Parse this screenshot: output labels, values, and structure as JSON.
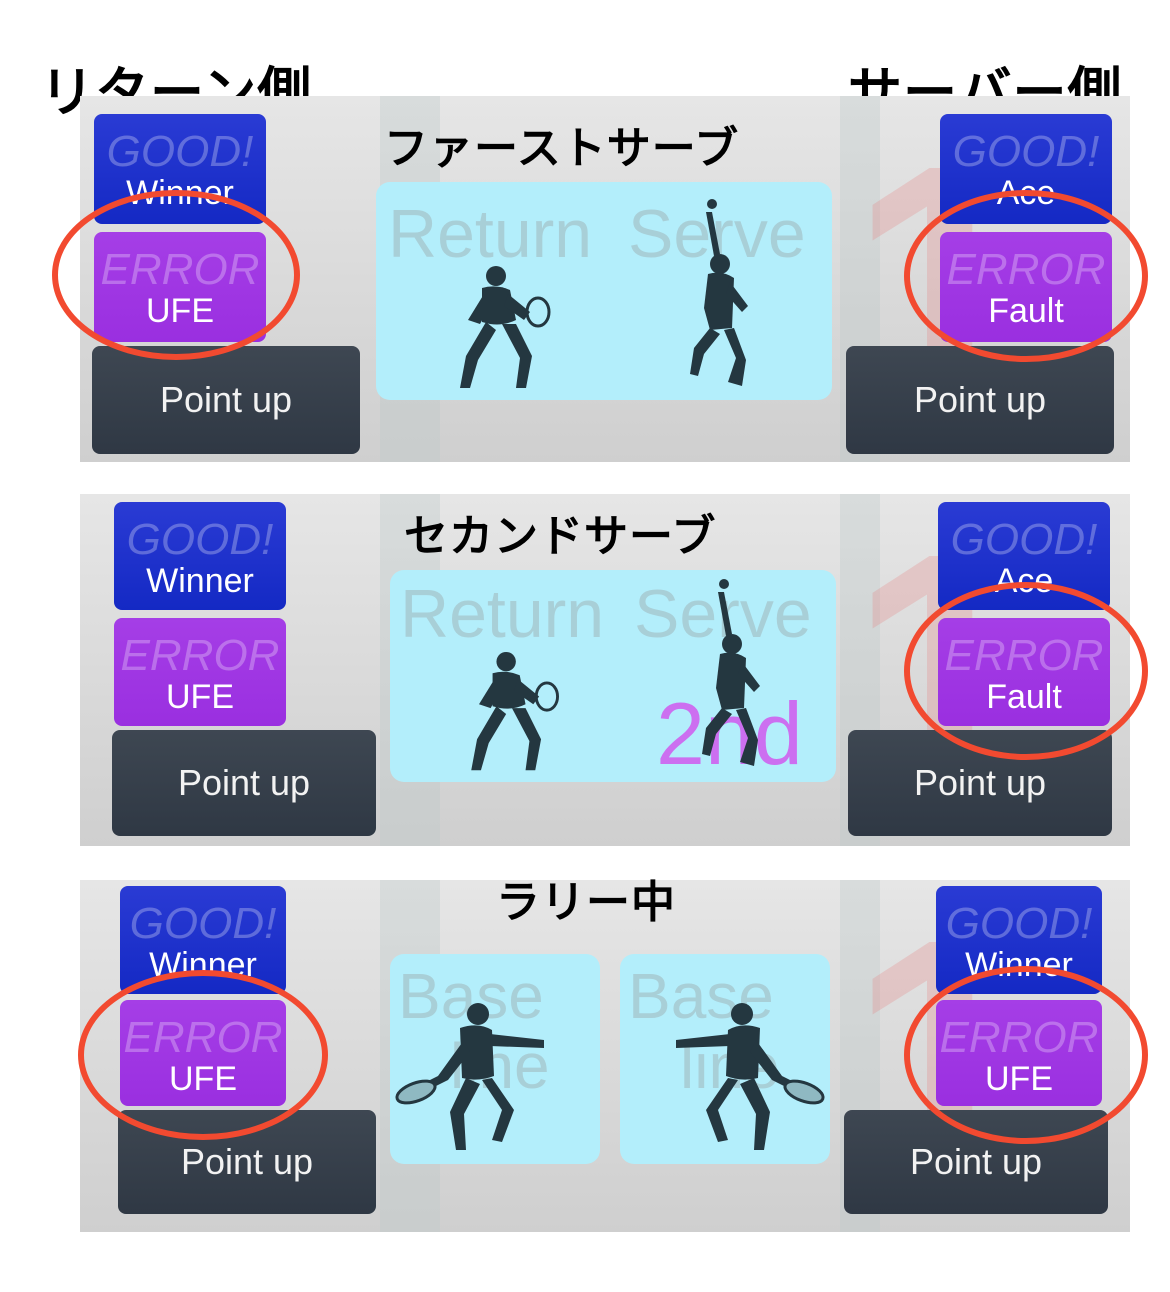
{
  "labels": {
    "return_side": "リターン側",
    "server_side": "サーバー側"
  },
  "panels": [
    {
      "title": "ファーストサーブ",
      "left": {
        "good_top": "GOOD!",
        "good_main": "Winner",
        "error_top": "ERROR",
        "error_main": "UFE",
        "point": "Point up"
      },
      "right": {
        "good_top": "GOOD!",
        "good_main": "Ace",
        "error_top": "ERROR",
        "error_main": "Fault",
        "point": "Point up"
      },
      "court": {
        "left_word": "Return",
        "right_word": "Serve"
      }
    },
    {
      "title": "セカンドサーブ",
      "left": {
        "good_top": "GOOD!",
        "good_main": "Winner",
        "error_top": "ERROR",
        "error_main": "UFE",
        "point": "Point up"
      },
      "right": {
        "good_top": "GOOD!",
        "good_main": "Ace",
        "error_top": "ERROR",
        "error_main": "Fault",
        "point": "Point up"
      },
      "court": {
        "left_word": "Return",
        "right_word": "Serve",
        "badge": "2nd"
      }
    },
    {
      "title": "ラリー中",
      "left": {
        "good_top": "GOOD!",
        "good_main": "Winner",
        "error_top": "ERROR",
        "error_main": "UFE",
        "point": "Point up"
      },
      "right": {
        "good_top": "GOOD!",
        "good_main": "Winner",
        "error_top": "ERROR",
        "error_main": "UFE",
        "point": "Point up"
      },
      "court": {
        "left_word1": "Base",
        "left_word2": "line",
        "right_word1": "Base",
        "right_word2": "line"
      }
    }
  ],
  "colors": {
    "good_button": "#1e33cc",
    "error_button": "#a035e3",
    "point_button": "#363f4a",
    "court": "#b3eefb",
    "highlight_circle": "#f24a30"
  },
  "icons": [
    "returner-silhouette-icon",
    "server-silhouette-icon",
    "baseline-player-silhouette-icon"
  ]
}
